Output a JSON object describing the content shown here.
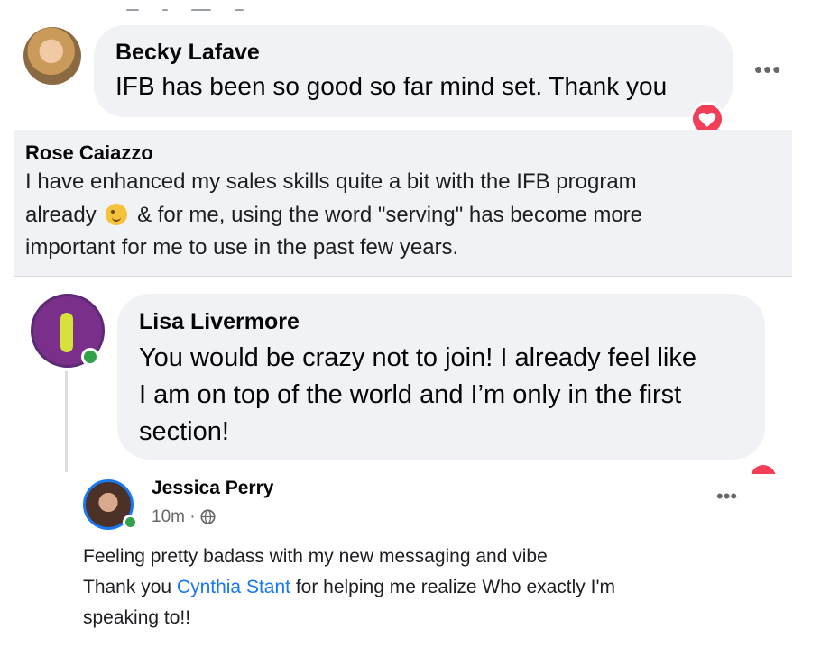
{
  "comments": [
    {
      "author": "Becky Lafave",
      "text": "IFB has been so good so far mind set. Thank you",
      "reaction": "heart-icon",
      "menu": "•••"
    },
    {
      "author": "Rose Caiazzo",
      "lines": [
        "I have enhanced my sales skills quite a bit with the IFB program",
        "already",
        "& for me, using the word \"serving\" has become more",
        "important for me to use in the past few years."
      ],
      "emoji": "winking-face-icon"
    },
    {
      "author": "Lisa Livermore",
      "lines": [
        "You would be crazy not to join! I already feel like",
        "I am on top of the world and I’m only in the first",
        "section!"
      ]
    }
  ],
  "post": {
    "author": "Jessica Perry",
    "time": "10m",
    "separator": "·",
    "privacy_icon": "globe-icon",
    "menu": "•••",
    "line1": "Feeling pretty badass with my new messaging and vibe",
    "line2_before": "Thank you ",
    "mention": "Cynthia Stant",
    "line2_after": " for helping me realize Who exactly I'm",
    "line3": "speaking to!!"
  },
  "colors": {
    "bubble": "#f0f2f5",
    "link": "#1877f2",
    "online": "#31a24c",
    "heart": "#f33e58",
    "muted": "#65676b"
  }
}
